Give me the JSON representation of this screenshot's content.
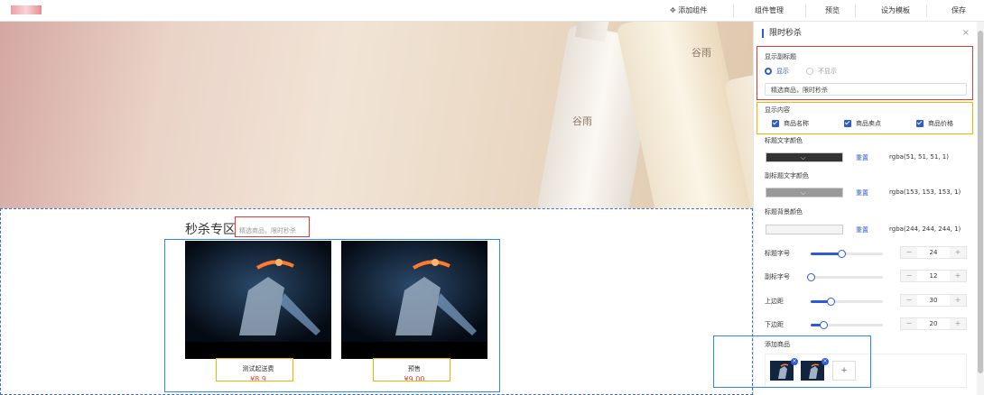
{
  "topbar": {
    "add_component": "添加组件",
    "component_manage": "组件管理",
    "preview": "预览",
    "set_template": "设为模板",
    "save": "保存"
  },
  "canvas": {
    "banner": {
      "brand": "谷雨",
      "brand2": "谷雨"
    },
    "section": {
      "title": "秒杀专区",
      "subtitle": "精选商品，限时秒杀"
    },
    "products": [
      {
        "name": "测试起送费",
        "price": "¥8.9"
      },
      {
        "name": "预售",
        "price": "¥9.00"
      }
    ]
  },
  "panel": {
    "title": "限时秒杀",
    "close": "×",
    "show_subtitle_label": "显示副标题",
    "radio_show": "显示",
    "radio_hide": "不显示",
    "subtitle_value": "精选商品，限时秒杀",
    "show_content_label": "显示内容",
    "check_name": "商品名称",
    "check_selling_point": "商品卖点",
    "check_price": "商品价格",
    "title_color_label": "标题文字颜色",
    "title_color_value": "rgba(51, 51, 51, 1)",
    "subtitle_color_label": "副标题文字颜色",
    "subtitle_color_value": "rgba(153, 153, 153, 1)",
    "title_bg_label": "标题背景颜色",
    "title_bg_value": "rgba(244, 244, 244, 1)",
    "reset": "重置",
    "title_fontsize_label": "标题字号",
    "title_fontsize": "24",
    "subtitle_fontsize_label": "副标字号",
    "subtitle_fontsize": "12",
    "margin_top_label": "上边距",
    "margin_top": "30",
    "margin_bottom_label": "下边距",
    "margin_bottom": "20",
    "add_product_label": "添加商品",
    "minus": "−",
    "plus": "+",
    "add": "+",
    "colors": {
      "title_swatch": "#333333",
      "subtitle_swatch": "#999999",
      "bg_swatch": "#f4f4f4",
      "accent": "#2d5bd7"
    },
    "sliders": {
      "title_fontsize_frac": 0.42,
      "subtitle_fontsize_frac": 0.0,
      "margin_top_frac": 0.28,
      "margin_bottom_frac": 0.18
    }
  }
}
